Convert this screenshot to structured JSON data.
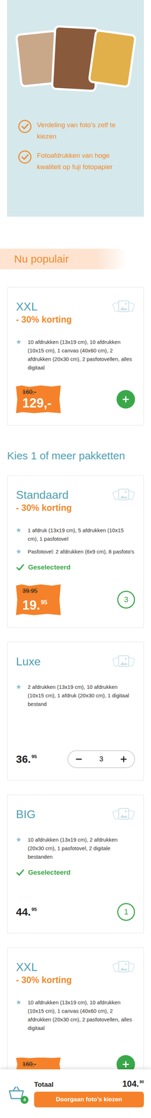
{
  "hero": {
    "features": [
      "Verdeling van foto's zelf te kiezen",
      "Fotoafdrukken van hoge kwaliteit op fuji fotopapier"
    ]
  },
  "sections": [
    {
      "heading": "Nu populair",
      "packages": [
        {
          "name": "XXL",
          "discount": "- 30% korting",
          "items": [
            "10 afdrukken (13x19 cm), 10 afdrukken (10x15 cm), 1 canvas (40x60 cm), 2 afdrukken (20x30 cm), 2 pasfotovellen, alles digitaal"
          ],
          "selected": false,
          "price": {
            "old": "160,-",
            "whole": "129,-",
            "cents": ""
          },
          "control": {
            "kind": "add",
            "quantity": ""
          }
        }
      ]
    },
    {
      "heading": "Kies 1 of meer pakketten",
      "packages": [
        {
          "name": "Standaard",
          "discount": "- 30% korting",
          "items": [
            "1 afdruk (13x19 cm), 5 afdrukken (10x15 cm), 1 pasfotovel",
            "Pasfotovel: 2 afdrukken (6x9 cm), 8 pasfoto's"
          ],
          "selected": true,
          "price": {
            "old": "39.95",
            "whole": "19.",
            "cents": "95"
          },
          "control": {
            "kind": "count",
            "quantity": "3"
          }
        },
        {
          "name": "Luxe",
          "discount": "",
          "items": [
            "2 afdrukken (13x19 cm), 10 afdrukken (10x15 cm), 1 afdruk (20x30 cm), 1 digitaal bestand"
          ],
          "selected": false,
          "price": {
            "old": "",
            "whole": "36.",
            "cents": "95"
          },
          "control": {
            "kind": "stepper",
            "quantity": "3"
          }
        },
        {
          "name": "BIG",
          "discount": "",
          "items": [
            "10 afdrukken (13x19 cm), 2 afdrukken (20x30 cm), 1 pasfotovel, 2 digitale bestanden"
          ],
          "selected": true,
          "price": {
            "old": "",
            "whole": "44.",
            "cents": "95"
          },
          "control": {
            "kind": "count",
            "quantity": "1"
          }
        },
        {
          "name": "XXL",
          "discount": "- 30% korting",
          "items": [
            "10 afdrukken (13x19 cm), 10 afdrukken (10x15 cm), 1 canvas (40x60 cm), 2 afdrukken (20x30 cm), 2 pasfotovellen, alles digitaal"
          ],
          "selected": false,
          "price": {
            "old": "160,-",
            "whole": "",
            "cents": ""
          },
          "control": {
            "kind": "add",
            "quantity": ""
          }
        }
      ]
    }
  ],
  "selected_label": "Geselecteerd",
  "cart": {
    "badge": "4",
    "label": "Totaal",
    "whole": "104.",
    "cents": "80",
    "button": "Doorgaan foto's kiezen"
  }
}
